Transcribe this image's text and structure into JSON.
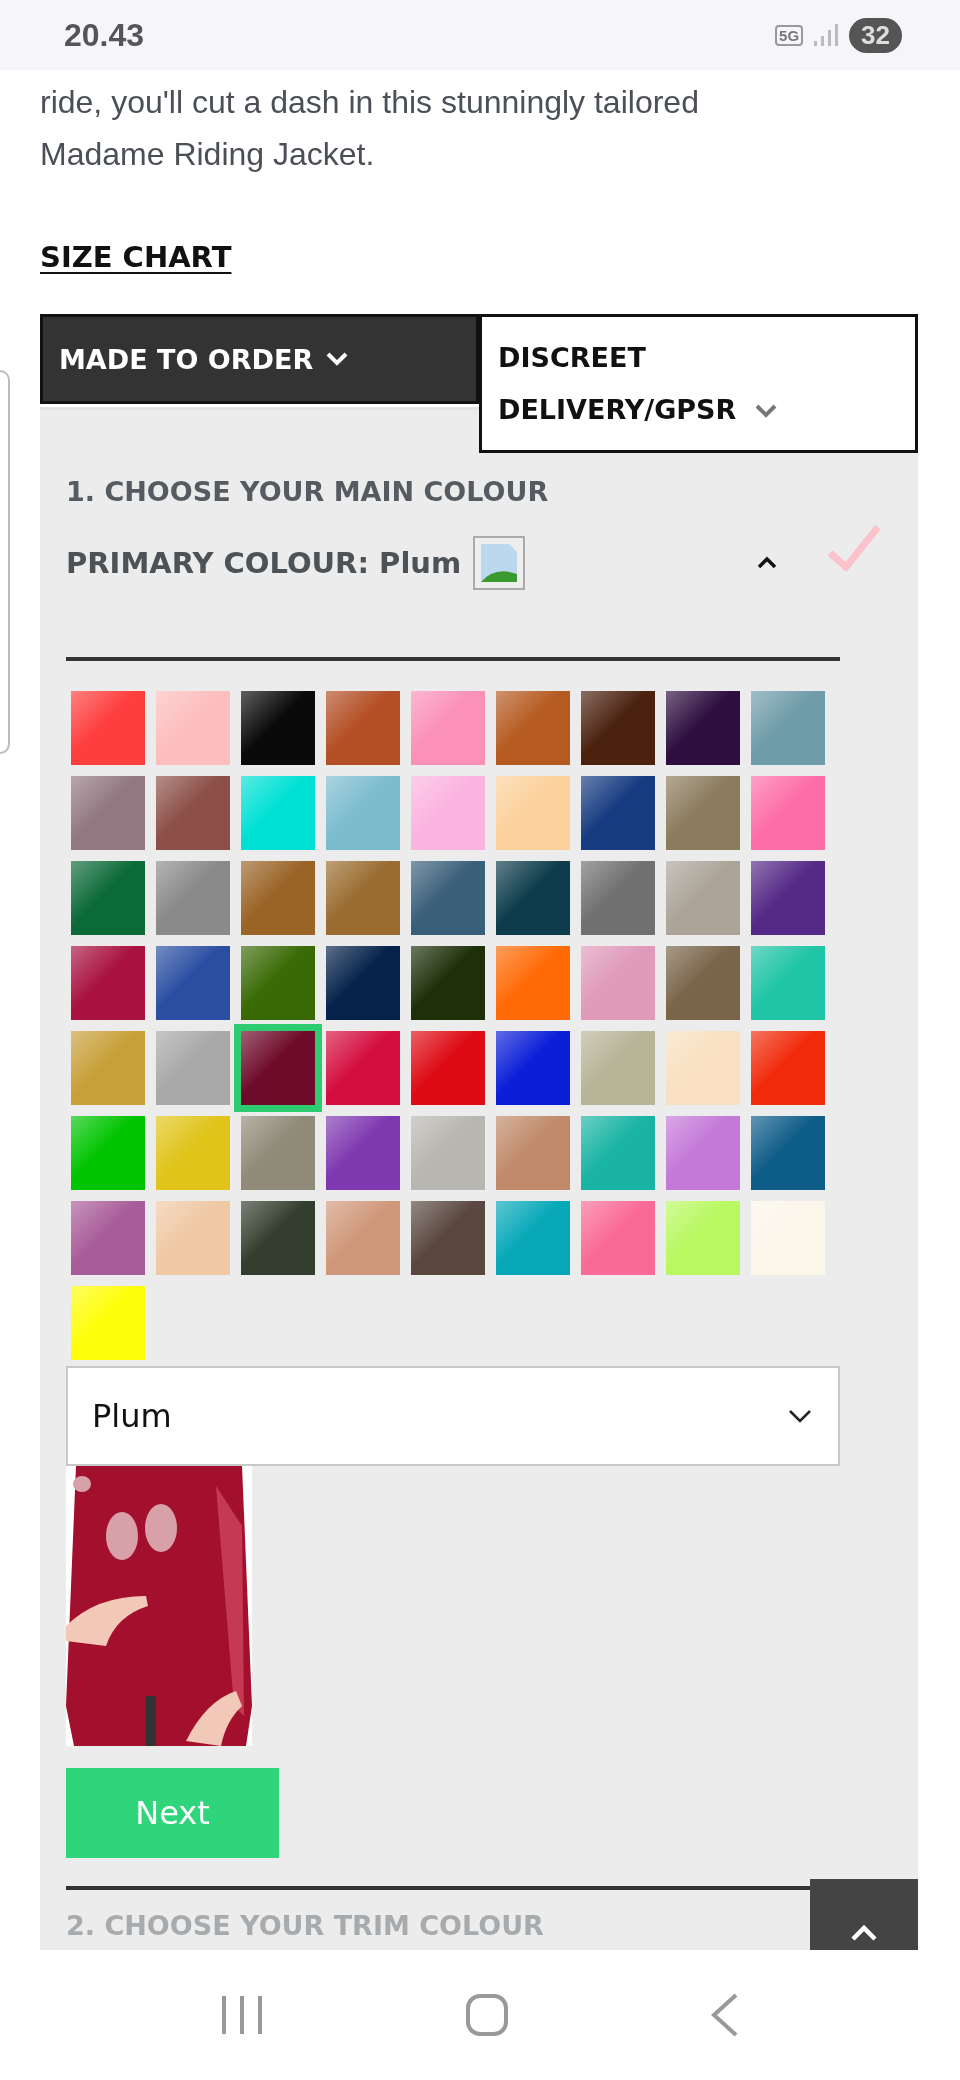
{
  "status_bar": {
    "time": "20.43",
    "network": "5G",
    "battery": "32"
  },
  "description": [
    "ride, you'll cut a dash in this stunningly tailored",
    "Madame Riding Jacket."
  ],
  "size_chart_link": "SIZE CHART",
  "tabs": [
    {
      "label": "MADE TO ORDER",
      "selected": true
    },
    {
      "label": "DISCREET DELIVERY/GPSR",
      "selected": false
    }
  ],
  "step1": {
    "heading": "1. CHOOSE YOUR MAIN COLOUR",
    "primary_label": "PRIMARY COLOUR:",
    "primary_value": "Plum",
    "expanded": true,
    "complete": true,
    "swatches": [
      {
        "color": "#fe3d3d",
        "selected": false
      },
      {
        "color": "#fcbdbd",
        "selected": false
      },
      {
        "color": "#0a0a0a",
        "selected": false
      },
      {
        "color": "#b34e25",
        "selected": false
      },
      {
        "color": "#fb90b8",
        "selected": false
      },
      {
        "color": "#b55a21",
        "selected": false
      },
      {
        "color": "#4b2210",
        "selected": false
      },
      {
        "color": "#2e0e3f",
        "selected": false
      },
      {
        "color": "#6f9ca9",
        "selected": false
      },
      {
        "color": "#927880",
        "selected": false
      },
      {
        "color": "#8c5048",
        "selected": false
      },
      {
        "color": "#00e0d4",
        "selected": false
      },
      {
        "color": "#7cbccf",
        "selected": false
      },
      {
        "color": "#fbb4e0",
        "selected": false
      },
      {
        "color": "#fbd09a",
        "selected": false
      },
      {
        "color": "#163b80",
        "selected": false
      },
      {
        "color": "#8c7c5e",
        "selected": false
      },
      {
        "color": "#fd6ea8",
        "selected": false
      },
      {
        "color": "#0c6a39",
        "selected": false
      },
      {
        "color": "#8a8a8a",
        "selected": false
      },
      {
        "color": "#9a6427",
        "selected": false
      },
      {
        "color": "#9a6c30",
        "selected": false
      },
      {
        "color": "#3a5f7a",
        "selected": false
      },
      {
        "color": "#0e3c4c",
        "selected": false
      },
      {
        "color": "#707070",
        "selected": false
      },
      {
        "color": "#aca498",
        "selected": false
      },
      {
        "color": "#552a86",
        "selected": false
      },
      {
        "color": "#a81140",
        "selected": false
      },
      {
        "color": "#2a4ea2",
        "selected": false
      },
      {
        "color": "#3a6a06",
        "selected": false
      },
      {
        "color": "#04224a",
        "selected": false
      },
      {
        "color": "#1e300a",
        "selected": false
      },
      {
        "color": "#ff6a06",
        "selected": false
      },
      {
        "color": "#e09aba",
        "selected": false
      },
      {
        "color": "#7a654a",
        "selected": false
      },
      {
        "color": "#20c4a6",
        "selected": false
      },
      {
        "color": "#c8a03a",
        "selected": false
      },
      {
        "color": "#a8a8a8",
        "selected": false
      },
      {
        "color": "#6e0a2a",
        "selected": true
      },
      {
        "color": "#d40e40",
        "selected": false
      },
      {
        "color": "#de0a14",
        "selected": false
      },
      {
        "color": "#0a1ed8",
        "selected": false
      },
      {
        "color": "#b8b498",
        "selected": false
      },
      {
        "color": "#f8e0c0",
        "selected": false
      },
      {
        "color": "#f02a0a",
        "selected": false
      },
      {
        "color": "#00c400",
        "selected": false
      },
      {
        "color": "#e0c41a",
        "selected": false
      },
      {
        "color": "#908a78",
        "selected": false
      },
      {
        "color": "#7e38b0",
        "selected": false
      },
      {
        "color": "#b8b6b0",
        "selected": false
      },
      {
        "color": "#c08a6a",
        "selected": false
      },
      {
        "color": "#1ab4a4",
        "selected": false
      },
      {
        "color": "#c478d8",
        "selected": false
      },
      {
        "color": "#0e5c88",
        "selected": false
      },
      {
        "color": "#a85c98",
        "selected": false
      },
      {
        "color": "#f0c8a4",
        "selected": false
      },
      {
        "color": "#343e2e",
        "selected": false
      },
      {
        "color": "#d0987a",
        "selected": false
      },
      {
        "color": "#5a4840",
        "selected": false
      },
      {
        "color": "#06a8b8",
        "selected": false
      },
      {
        "color": "#fa6a96",
        "selected": false
      },
      {
        "color": "#b8f860",
        "selected": false
      },
      {
        "color": "#fbf6ea",
        "selected": false
      },
      {
        "color": "#fefe0a",
        "selected": false
      }
    ],
    "select": {
      "value": "Plum"
    },
    "next_button": "Next"
  },
  "step2": {
    "heading": "2. CHOOSE YOUR TRIM COLOUR"
  }
}
